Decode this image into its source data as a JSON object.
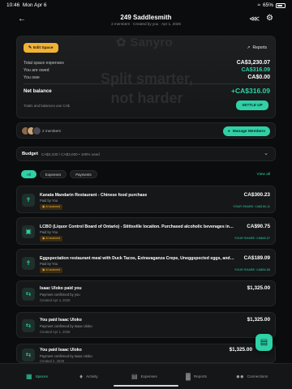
{
  "status": {
    "time": "10:46",
    "date": "Mon Apr 6",
    "battery": "65%"
  },
  "header": {
    "title": "249 Saddlesmith",
    "subtitle": "2 members · Created by you · Apr 1, 2026"
  },
  "hero": {
    "logo_text": "Sanyro",
    "watermark_line1": "Split smarter,",
    "watermark_line2": "not harder",
    "edit_label": "Edit Space",
    "reports_label": "Reports",
    "rows": [
      {
        "label": "Total space expenses",
        "value": "CA$3,230.07"
      },
      {
        "label": "You are owed",
        "value": "CA$316.09"
      },
      {
        "label": "You owe",
        "value": "CA$0.00"
      }
    ],
    "net_label": "Net balance",
    "net_value": "+CA$316.09",
    "note": "Totals and balances use CA$",
    "settle_label": "SETTLE UP"
  },
  "members": {
    "count_label": "2 members",
    "manage_label": "Manage Members"
  },
  "budget": {
    "label": "Budget",
    "info": "CA$3,230 / CA$3,000 • 108% used"
  },
  "filters": {
    "chips": [
      "All",
      "Expenses",
      "Payments"
    ],
    "active": "All",
    "view_all": "View all"
  },
  "activity": [
    {
      "title": "Kanata Mandarin Restaurant - Chinese food purchase",
      "amount": "CA$300.23",
      "paid_by": "Paid by You",
      "badge": "AI scanned",
      "share": "YOUR SHARE: CA$150.11"
    },
    {
      "title": "LCBO (Liquor Control Board of Ontario) - Stittsville location. Purchased alcoholic beverages includi...",
      "amount": "CA$90.75",
      "paid_by": "Paid by You",
      "badge": "AI scanned",
      "share": "YOUR SHARE: CA$45.37"
    },
    {
      "title": "Eggspectation restaurant meal with Duck Tacos, Extravaganza Crepe, Uneggspected eggs, and Co...",
      "amount": "CA$189.09",
      "paid_by": "Paid by You",
      "badge": "AI scanned",
      "share": "YOUR SHARE: CA$94.55"
    },
    {
      "title": "Isaac Uloko paid you",
      "amount": "$1,325.00",
      "confirmed": "Payment confirmed by you",
      "created": "Created Apr 4, 2026"
    },
    {
      "title": "You paid Isaac Uloko",
      "amount": "$1,325.00",
      "confirmed": "Payment confirmed by Isaac Uloko",
      "created": "Created Apr 1, 2026"
    },
    {
      "title": "You paid Isaac Uloko",
      "amount": "$1,325.00",
      "confirmed": "Payment confirmed by Isaac Uloko",
      "created": "Created 2, 2026"
    }
  ],
  "tabs": [
    {
      "label": "Spaces",
      "icon": "calendar-icon"
    },
    {
      "label": "Activity",
      "icon": "bell-icon"
    },
    {
      "label": "Expenses",
      "icon": "receipt-icon"
    },
    {
      "label": "Reports",
      "icon": "bar-chart-icon"
    },
    {
      "label": "Connections",
      "icon": "people-icon"
    }
  ],
  "colors": {
    "accent": "#2fd1a6",
    "warning": "#f2b233",
    "background": "#0b0c0d"
  }
}
